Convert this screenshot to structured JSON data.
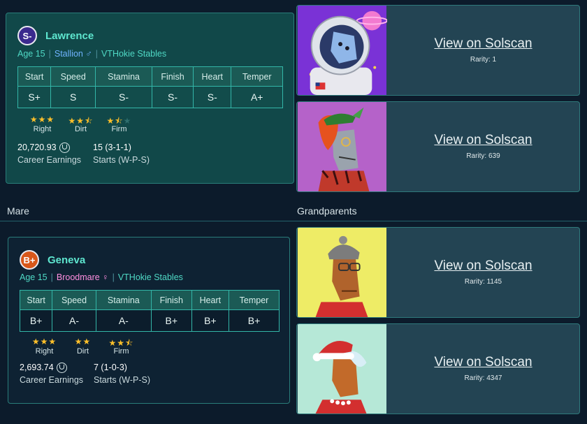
{
  "sire": {
    "grade": "S-",
    "name": "Lawrence",
    "age": "Age 15",
    "gender": "Stallion ♂",
    "stable": "VTHokie Stables",
    "stat_headers": [
      "Start",
      "Speed",
      "Stamina",
      "Finish",
      "Heart",
      "Temper"
    ],
    "stat_values": [
      "S+",
      "S",
      "S-",
      "S-",
      "S-",
      "A+"
    ],
    "ratings": [
      {
        "label": "Right",
        "stars": "★★★",
        "dim": ""
      },
      {
        "label": "Dirt",
        "stars": "★★⯪",
        "dim": ""
      },
      {
        "label": "Firm",
        "stars": "★⯪",
        "dim": "★"
      }
    ],
    "earnings": "20,720.93",
    "earnings_label": "Career Earnings",
    "starts": "15 (3-1-1)",
    "starts_label": "Starts (W-P-S)"
  },
  "dam": {
    "grade": "B+",
    "name": "Geneva",
    "age": "Age 15",
    "gender": "Broodmare ♀",
    "stable": "VTHokie Stables",
    "stat_headers": [
      "Start",
      "Speed",
      "Stamina",
      "Finish",
      "Heart",
      "Temper"
    ],
    "stat_values": [
      "B+",
      "A-",
      "A-",
      "B+",
      "B+",
      "B+"
    ],
    "ratings": [
      {
        "label": "Right",
        "stars": "★★★",
        "dim": ""
      },
      {
        "label": "Dirt",
        "stars": "★★",
        "dim": ""
      },
      {
        "label": "Firm",
        "stars": "★★⯪",
        "dim": ""
      }
    ],
    "earnings": "2,693.74",
    "earnings_label": "Career Earnings",
    "starts": "7 (1-0-3)",
    "starts_label": "Starts (W-P-S)"
  },
  "sections": {
    "mare": "Mare",
    "grandparents": "Grandparents"
  },
  "nfts": [
    {
      "link": "View on Solscan",
      "rarity": "Rarity: 1",
      "art": "astronaut-horse-art"
    },
    {
      "link": "View on Solscan",
      "rarity": "Rarity: 639",
      "art": "hat-horse-art"
    },
    {
      "link": "View on Solscan",
      "rarity": "Rarity: 1145",
      "art": "beanie-horse-art"
    },
    {
      "link": "View on Solscan",
      "rarity": "Rarity: 4347",
      "art": "santa-horse-art"
    }
  ],
  "colors": {
    "accent": "#5ee6cf",
    "star": "#ffc02a",
    "nft_bg": [
      "#7a32d6",
      "#b562c9",
      "#eeec66",
      "#b6e8d7"
    ]
  }
}
